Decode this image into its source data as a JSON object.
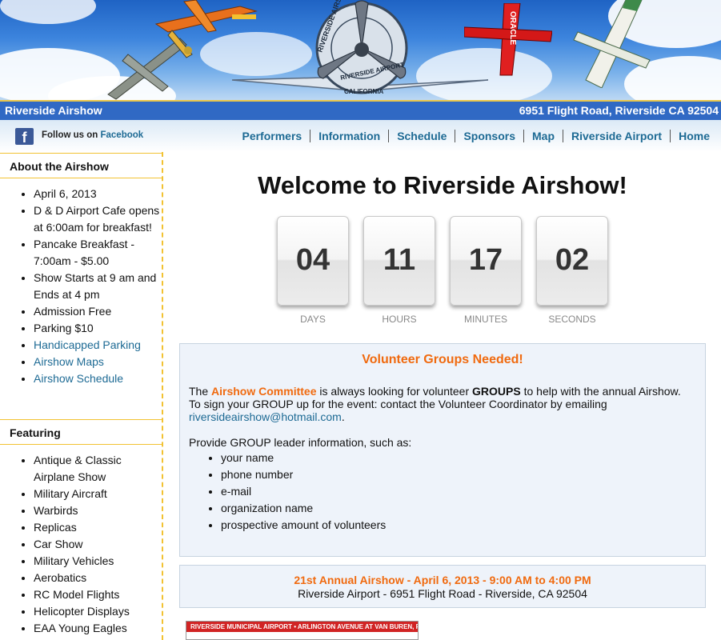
{
  "banner": {
    "logo_text_top": "RIVERSIDE AIRSHOW",
    "logo_text_bottom": "RIVERSIDE AIRPORT",
    "logo_text_state": "CALIFORNIA",
    "plane_text_oracle": "ORACLE"
  },
  "titlebar": {
    "site_name": "Riverside Airshow",
    "address": "6951 Flight Road, Riverside CA 92504"
  },
  "social": {
    "follow_prefix": "Follow us on",
    "facebook_label": "Facebook",
    "facebook_icon_glyph": "f"
  },
  "nav": {
    "items": [
      "Performers",
      "Information",
      "Schedule",
      "Sponsors",
      "Map",
      "Riverside Airport",
      "Home"
    ]
  },
  "sidebar": {
    "about_heading": "About the Airshow",
    "about_items": [
      "April 6, 2013",
      "D & D Airport Cafe opens at 6:00am for breakfast!",
      "Pancake Breakfast - 7:00am - $5.00",
      "Show Starts at 9 am and Ends at 4 pm",
      "Admission Free",
      "Parking $10"
    ],
    "about_links": [
      "Handicapped Parking",
      "Airshow Maps",
      "Airshow Schedule"
    ],
    "featuring_heading": "Featuring",
    "featuring_items": [
      "Antique & Classic Airplane Show",
      "Military Aircraft",
      "Warbirds",
      "Replicas",
      "Car Show",
      "Military Vehicles",
      "Aerobatics",
      "RC Model Flights",
      "Helicopter Displays",
      "EAA Young Eagles"
    ]
  },
  "main": {
    "welcome_title": "Welcome to Riverside Airshow!",
    "countdown": {
      "days": "04",
      "hours": "11",
      "minutes": "17",
      "seconds": "02",
      "days_label": "DAYS",
      "hours_label": "HOURS",
      "minutes_label": "MINUTES",
      "seconds_label": "SECONDS"
    },
    "volunteer": {
      "title": "Volunteer Groups Needed!",
      "intro_the": "The",
      "committee": "Airshow Committee",
      "intro_middle": "is always looking for volunteer",
      "groups": "GROUPS",
      "intro_end": "to help with the annual Airshow.",
      "signup_text": "To sign your GROUP up for the event: contact the Volunteer Coordinator by emailing",
      "email": "riversideairshow@hotmail.com",
      "period": ".",
      "provide_text": "Provide GROUP leader information, such as:",
      "items": [
        "your name",
        "phone number",
        "e-mail",
        "organization name",
        "prospective amount of volunteers"
      ]
    },
    "event": {
      "line1": "21st Annual Airshow - April 6, 2013 - 9:00 AM to 4:00 PM",
      "line2": "Riverside Airport - 6951 Flight Road - Riverside, CA 92504"
    },
    "map_thumb": {
      "strip_text": "RIVERSIDE MUNICIPAL AIRPORT • ARLINGTON AVENUE AT VAN BUREN, RIVERSIDE"
    }
  },
  "colors": {
    "title_bar": "#3069c4",
    "accent_orange": "#f06a0f",
    "link_blue": "#1d6a94",
    "sidebar_border": "#f2c232",
    "box_bg": "#eef3fa"
  }
}
